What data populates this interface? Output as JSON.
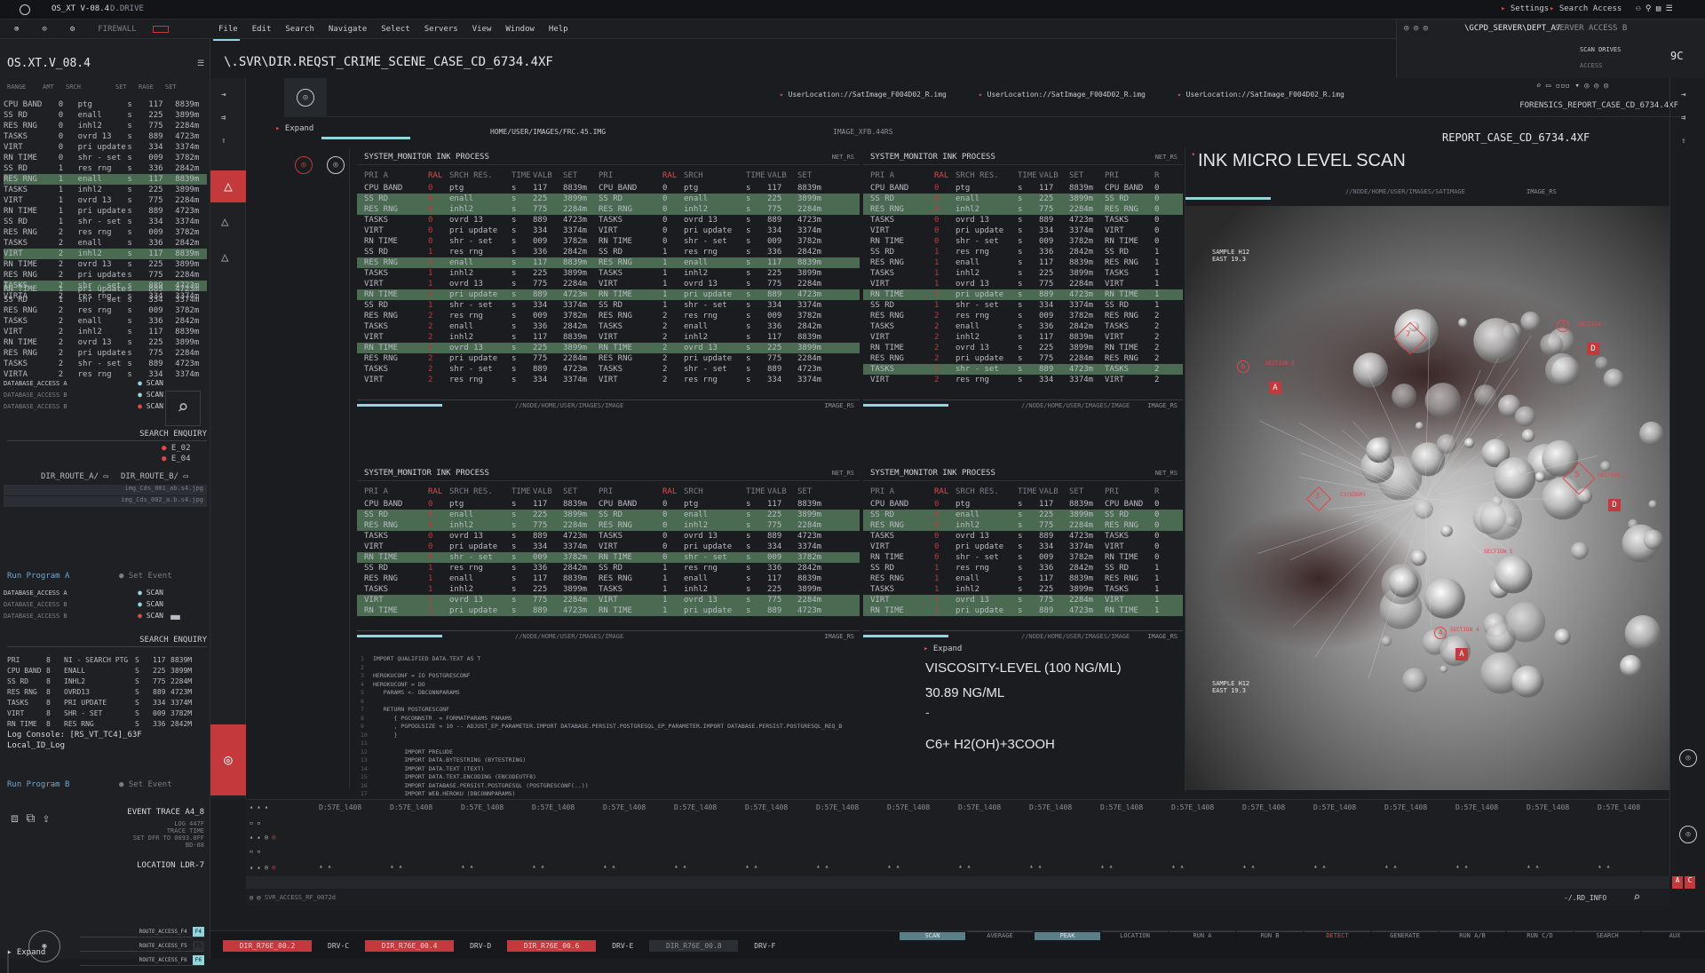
{
  "topbar": {
    "title": "OS_XT V-08.4",
    "drive": "D.DRIVE",
    "firewall": "FIREWALL",
    "settings": "Settings",
    "search_access": "Search Access"
  },
  "menu": [
    "File",
    "Edit",
    "Search",
    "Navigate",
    "Select",
    "Servers",
    "View",
    "Window",
    "Help"
  ],
  "server_path": "\\GCPD_SERVER\\DEPT_A7",
  "server_access": "SERVER ACCESS B",
  "scan_drives": "SCAN DRIVES",
  "access_label": "ACCESS",
  "server_code": "9C",
  "left": {
    "title": "OS.XT.V_08.4",
    "headers": [
      "RANGE",
      "AMT",
      "SRCH",
      "SET",
      "RAGE",
      "SET"
    ],
    "rows_a": [
      [
        "CPU BAND",
        "0",
        "ptg",
        "s",
        "117",
        "8839m"
      ],
      [
        "SS RD",
        "0",
        "enall",
        "s",
        "225",
        "3899m"
      ],
      [
        "RES RNG",
        "0",
        "inhl2",
        "s",
        "775",
        "2284m"
      ],
      [
        "TASKS",
        "0",
        "ovrd 13",
        "s",
        "889",
        "4723m"
      ],
      [
        "VIRT",
        "0",
        "pri update",
        "s",
        "334",
        "3374m"
      ],
      [
        "RN TIME",
        "0",
        "shr - set",
        "s",
        "009",
        "3782m"
      ],
      [
        "SS RD",
        "1",
        "res rng",
        "s",
        "336",
        "2842m"
      ],
      [
        "RES RNG",
        "1",
        "enall",
        "s",
        "117",
        "8839m"
      ],
      [
        "TASKS",
        "1",
        "inhl2",
        "s",
        "225",
        "3899m"
      ],
      [
        "VIRT",
        "1",
        "ovrd 13",
        "s",
        "775",
        "2284m"
      ],
      [
        "RN TIME",
        "1",
        "pri update",
        "s",
        "889",
        "4723m"
      ],
      [
        "SS RD",
        "1",
        "shr - set",
        "s",
        "334",
        "3374m"
      ],
      [
        "RES RNG",
        "2",
        "res rng",
        "s",
        "009",
        "3782m"
      ],
      [
        "TASKS",
        "2",
        "enall",
        "s",
        "336",
        "2842m"
      ],
      [
        "VIRT",
        "2",
        "inhl2",
        "s",
        "117",
        "8839m"
      ],
      [
        "RN TIME",
        "2",
        "ovrd 13",
        "s",
        "225",
        "3899m"
      ],
      [
        "RES RNG",
        "2",
        "pri update",
        "s",
        "775",
        "2284m"
      ],
      [
        "TASKS",
        "2",
        "shr - set",
        "s",
        "889",
        "4723m"
      ],
      [
        "VIRTA",
        "2",
        "res rng",
        "s",
        "334",
        "3374m"
      ]
    ],
    "rows_b": [
      [
        "RN TIME",
        "1",
        "pri update",
        "s",
        "889",
        "4723m"
      ],
      [
        "SS RD",
        "1",
        "shr - set",
        "s",
        "334",
        "3374m"
      ],
      [
        "RES RNG",
        "2",
        "res rng",
        "s",
        "009",
        "3782m"
      ],
      [
        "TASKS",
        "2",
        "enall",
        "s",
        "336",
        "2842m"
      ],
      [
        "VIRT",
        "2",
        "inhl2",
        "s",
        "117",
        "8839m"
      ],
      [
        "RN TIME",
        "2",
        "ovrd 13",
        "s",
        "225",
        "3899m"
      ],
      [
        "RES RNG",
        "2",
        "pri update",
        "s",
        "775",
        "2284m"
      ],
      [
        "TASKS",
        "2",
        "shr - set",
        "s",
        "889",
        "4723m"
      ],
      [
        "VIRTA",
        "2",
        "res rng",
        "s",
        "334",
        "3374m"
      ]
    ],
    "db_access": [
      "DATABASE_ACCESS A",
      "DATABASE_ACCESS B",
      "DATABASE_ACCESS B"
    ],
    "scan": "SCAN",
    "search_enquiry": "SEARCH ENQUIRY",
    "e_codes": [
      "E_02",
      "E_04"
    ],
    "route_a": "DIR_ROUTE_A/",
    "route_b": "DIR_ROUTE_B/",
    "img_files": [
      "img_Cds_001_ab.s4.jpg",
      "img_Cds_002_a.b.s4.jpg"
    ],
    "run_a": "Run Program A",
    "set_event": "Set Event",
    "db_access2": [
      "DATABASE_ACCESS A",
      "DATABASE_ACCESS B",
      "DATABASE_ACCESS B"
    ],
    "search_enquiry2": "SEARCH ENQUIRY",
    "rows_c": [
      [
        "PRI",
        "8",
        "NI - SEARCH PTG",
        "S",
        "117",
        "8839M"
      ],
      [
        "CPU BAND",
        "8",
        "ENALL",
        "S",
        "225",
        "3899M"
      ],
      [
        "SS RD",
        "8",
        "INHL2",
        "S",
        "775",
        "2284M"
      ],
      [
        "RES RNG",
        "8",
        "OVRD13",
        "S",
        "889",
        "4723M"
      ],
      [
        "TASKS",
        "8",
        "PRI UPDATE",
        "S",
        "334",
        "3374M"
      ],
      [
        "VIRT",
        "8",
        "SHR - SET",
        "S",
        "009",
        "3782M"
      ],
      [
        "RN TIME",
        "8",
        "RES RNG",
        "S",
        "336",
        "2842M"
      ]
    ],
    "log_console": "Log Console: [RS_VT_TC4]_63F",
    "local_log": "Local_ID_Log",
    "run_b": "Run Program B",
    "event_trace": "EVENT TRACE A4_8",
    "trace_lines": [
      "LOG 447F",
      "TRACE TIME",
      "SET DFR TO 0093.0FF",
      "BD-88"
    ],
    "location": "LOCATION LDR-7",
    "routes": [
      "ROUTE_ACCESS_F4",
      "ROUTE_ACCESS_F5",
      "ROUTE_ACCESS_F6"
    ],
    "route_tags": [
      "F4",
      "F5",
      "F6"
    ],
    "expand": "Expand"
  },
  "path_title": "\\.SVR\\DIR.REQST_CRIME_SCENE_CASE_CD_6734.4XF",
  "file_tabs": [
    "UserLocation://SatImage_F004D02_R.img",
    "UserLocation://SatImage_F004D02_R.img",
    "UserLocation://SatImage_F004D02_R.img"
  ],
  "forensics_report": "FORENSICS_REPORT_CASE_CD_6734.4XF",
  "report_case": "REPORT_CASE_CD_6734.4XF",
  "expand": "Expand",
  "home_path": "HOME/USER/IMAGES/FRC.45.IMG",
  "image_xfb": "IMAGE_XFB.44RS",
  "panel_title": "SYSTEM_MONITOR INK PROCESS",
  "net_rs": "NET_RS",
  "col_headers": [
    "PRI A",
    "RAL",
    "SRCH RES.",
    "TIME",
    "VALB",
    "SET",
    "PRI",
    "RAL",
    "SRCH",
    "TIME",
    "VALB",
    "SET"
  ],
  "col_headers_r": [
    "PRI A",
    "RAL",
    "SRCH RES.",
    "TIME",
    "VALB",
    "SET",
    "PRI",
    "R"
  ],
  "node_path": "//NODE/HOME/USER/IMAGES/IMAGE",
  "image_rs": "IMAGE_RS",
  "panel_rows": [
    [
      "CPU BAND",
      "0",
      "ptg",
      "s",
      "117",
      "8839m",
      "CPU BAND",
      "0",
      "ptg",
      "s",
      "117",
      "8839m"
    ],
    [
      "SS RD",
      "0",
      "enall",
      "s",
      "225",
      "3899m",
      "SS RD",
      "0",
      "enall",
      "s",
      "225",
      "3899m"
    ],
    [
      "RES RNG",
      "0",
      "inhl2",
      "s",
      "775",
      "2284m",
      "RES RNG",
      "0",
      "inhl2",
      "s",
      "775",
      "2284m"
    ],
    [
      "TASKS",
      "0",
      "ovrd 13",
      "s",
      "889",
      "4723m",
      "TASKS",
      "0",
      "ovrd 13",
      "s",
      "889",
      "4723m"
    ],
    [
      "VIRT",
      "0",
      "pri update",
      "s",
      "334",
      "3374m",
      "VIRT",
      "0",
      "pri update",
      "s",
      "334",
      "3374m"
    ],
    [
      "RN TIME",
      "0",
      "shr - set",
      "s",
      "009",
      "3782m",
      "RN TIME",
      "0",
      "shr - set",
      "s",
      "009",
      "3782m"
    ],
    [
      "SS RD",
      "1",
      "res rng",
      "s",
      "336",
      "2842m",
      "SS RD",
      "1",
      "res rng",
      "s",
      "336",
      "2842m"
    ],
    [
      "RES RNG",
      "1",
      "enall",
      "s",
      "117",
      "8839m",
      "RES RNG",
      "1",
      "enall",
      "s",
      "117",
      "8839m"
    ],
    [
      "TASKS",
      "1",
      "inhl2",
      "s",
      "225",
      "3899m",
      "TASKS",
      "1",
      "inhl2",
      "s",
      "225",
      "3899m"
    ],
    [
      "VIRT",
      "1",
      "ovrd 13",
      "s",
      "775",
      "2284m",
      "VIRT",
      "1",
      "ovrd 13",
      "s",
      "775",
      "2284m"
    ],
    [
      "RN TIME",
      "1",
      "pri update",
      "s",
      "889",
      "4723m",
      "RN TIME",
      "1",
      "pri update",
      "s",
      "889",
      "4723m"
    ],
    [
      "SS RD",
      "1",
      "shr - set",
      "s",
      "334",
      "3374m",
      "SS RD",
      "1",
      "shr - set",
      "s",
      "334",
      "3374m"
    ],
    [
      "RES RNG",
      "2",
      "res rng",
      "s",
      "009",
      "3782m",
      "RES RNG",
      "2",
      "res rng",
      "s",
      "009",
      "3782m"
    ],
    [
      "TASKS",
      "2",
      "enall",
      "s",
      "336",
      "2842m",
      "TASKS",
      "2",
      "enall",
      "s",
      "336",
      "2842m"
    ],
    [
      "VIRT",
      "2",
      "inhl2",
      "s",
      "117",
      "8839m",
      "VIRT",
      "2",
      "inhl2",
      "s",
      "117",
      "8839m"
    ],
    [
      "RN TIME",
      "2",
      "ovrd 13",
      "s",
      "225",
      "3899m",
      "RN TIME",
      "2",
      "ovrd 13",
      "s",
      "225",
      "3899m"
    ],
    [
      "RES RNG",
      "2",
      "pri update",
      "s",
      "775",
      "2284m",
      "RES RNG",
      "2",
      "pri update",
      "s",
      "775",
      "2284m"
    ],
    [
      "TASKS",
      "2",
      "shr - set",
      "s",
      "889",
      "4723m",
      "TASKS",
      "2",
      "shr - set",
      "s",
      "889",
      "4723m"
    ],
    [
      "VIRT",
      "2",
      "res rng",
      "s",
      "334",
      "3374m",
      "VIRT",
      "2",
      "res rng",
      "s",
      "334",
      "3374m"
    ]
  ],
  "code_lines": [
    "IMPORT QUALIFIED DATA.TEXT AS T",
    "",
    "HEROKUCONF = IO POSTGRESCONF",
    "HEROKUCONF = DO",
    "   PARAMS <- DBCONNPARAMS",
    "",
    "   RETURN POSTGRESCONF",
    "      { PGCONNSTR  = FORMATPARAMS PARAMS",
    "      , PGPOOLSIZE = 10 -- ADJUST_EP_PARAMETER.IMPORT DATABASE.PERSIST.POSTGRESQL_EP_PARAMETER.IMPORT DATABASE.PERSIST.POSTGRESQL_REQ_B",
    "      }",
    "",
    "         IMPORT PRELUDE",
    "         IMPORT DATA.BYTESTRING (BYTESTRING)",
    "         IMPORT DATA.TEXT (TEXT)",
    "         IMPORT DATA.TEXT.ENCODING (ENCODEUTF8)",
    "         IMPORT DATABASE.PERSIST.POSTGRESQL (POSTGRESCONF(..))",
    "         IMPORT WEB.HEROKU (DBCONNPARAMS)"
  ],
  "viscosity": {
    "expand": "Expand",
    "label": "VISCOSITY-LEVEL (100 NG/ML)",
    "dash": "-",
    "value": "30.89 NG/ML",
    "formula": "C6+  H2(OH)+3COOH"
  },
  "scan": {
    "title": "INK MICRO LEVEL SCAN",
    "path": "//NODE/HOME/USER/IMAGES/SATIMAGE",
    "image_rs": "IMAGE_RS",
    "sample1": "SAMPLE H12",
    "east1": "EAST 19.3",
    "sample2": "SAMPLE H12",
    "east2": "EAST 19.3",
    "markers": [
      "A",
      "D",
      "A",
      "D",
      "A"
    ],
    "ring_nums": [
      "7",
      "3",
      "6",
      "3",
      "5",
      "4"
    ],
    "section_labels": [
      "SECTION 1",
      "SECTION 2",
      "C3(H3OH)",
      "SECTION 3",
      "SECTION 4",
      "SECTION 5"
    ]
  },
  "timeline": {
    "stamp": "D:57E_l408",
    "count": 19,
    "rs_info": "-/.RD_INFO",
    "svr_access": "SVR_ACCESS_RF_0072d"
  },
  "bottom_tabs": [
    "DIR_R76E_00.2",
    "DRV-C",
    "DIR_R76E_00.4",
    "DRV-D",
    "DIR_R76E_00.6",
    "DRV-E",
    "DIR_R76E_00.8",
    "DRV-F"
  ],
  "bottom_buttons": [
    "SCAN",
    "AVERAGE",
    "PEAK",
    "LOCATION",
    "RUN A",
    "RUN B",
    "DETECT",
    "GENERATE",
    "RUN A/B",
    "RUN C/D",
    "SEARCH",
    "AUX"
  ],
  "colors": {
    "accent_red": "#c4393b",
    "highlight_green": "#4a6a52",
    "cyan": "#8fd6df"
  }
}
